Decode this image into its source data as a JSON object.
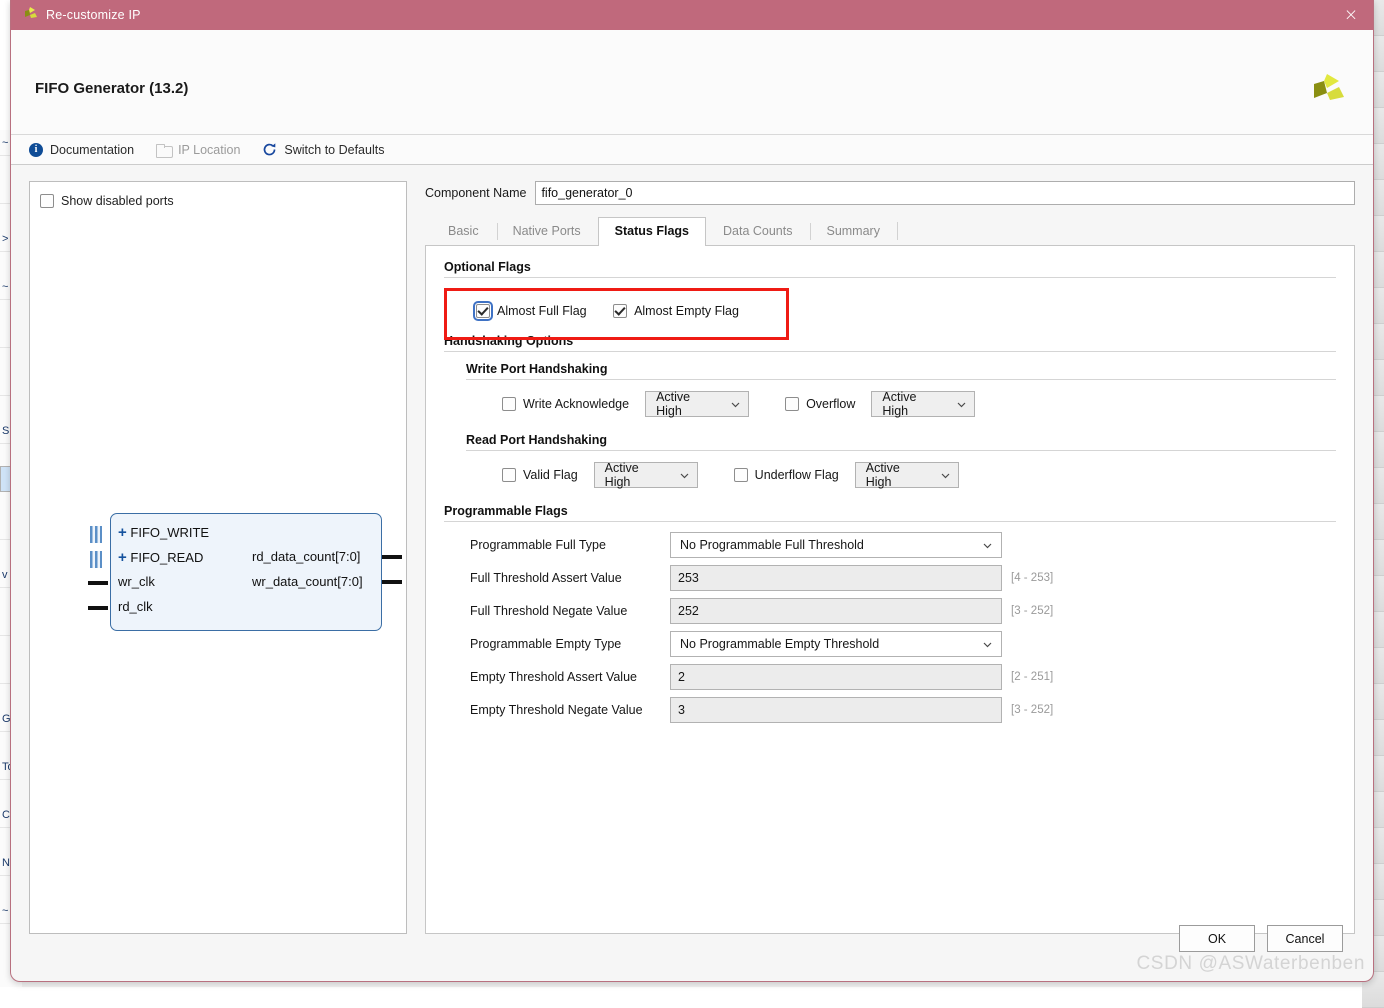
{
  "window": {
    "title": "Re-customize IP",
    "icon": "xilinx-logo-icon",
    "close_label": "×",
    "titlebar_color": "#c0697c"
  },
  "header": {
    "title": "FIFO Generator (13.2)",
    "logo": "xilinx-logo-icon"
  },
  "toolbar": {
    "items": [
      {
        "label": "Documentation",
        "icon": "info-icon",
        "disabled": false
      },
      {
        "label": "IP Location",
        "icon": "folder-icon",
        "disabled": true
      },
      {
        "label": "Switch to Defaults",
        "icon": "refresh-icon",
        "disabled": false
      }
    ]
  },
  "left_panel": {
    "show_disabled_ports": {
      "label": "Show disabled ports",
      "checked": false
    },
    "symbol": {
      "left_ports": [
        {
          "name": "FIFO_WRITE",
          "type": "bus",
          "expandable": true
        },
        {
          "name": "FIFO_READ",
          "type": "bus",
          "expandable": true
        },
        {
          "name": "wr_clk",
          "type": "clock",
          "expandable": false
        },
        {
          "name": "rd_clk",
          "type": "clock",
          "expandable": false
        }
      ],
      "right_ports": [
        {
          "name": "rd_data_count[7:0]",
          "type": "bus"
        },
        {
          "name": "wr_data_count[7:0]",
          "type": "bus"
        }
      ]
    }
  },
  "component_name": {
    "label": "Component Name",
    "value": "fifo_generator_0"
  },
  "tabs": [
    {
      "label": "Basic",
      "active": false
    },
    {
      "label": "Native Ports",
      "active": false
    },
    {
      "label": "Status Flags",
      "active": true
    },
    {
      "label": "Data Counts",
      "active": false
    },
    {
      "label": "Summary",
      "active": false
    }
  ],
  "optional_flags": {
    "title": "Optional Flags",
    "highlighted": true,
    "highlight_color": "#ef1b14",
    "items": [
      {
        "label": "Almost Full Flag",
        "checked": true,
        "focused": true
      },
      {
        "label": "Almost Empty Flag",
        "checked": true,
        "focused": false
      }
    ]
  },
  "handshaking": {
    "title": "Handshaking Options",
    "write_port": {
      "title": "Write Port Handshaking",
      "controls": [
        {
          "label": "Write Acknowledge",
          "checked": false,
          "polarity": "Active High"
        },
        {
          "label": "Overflow",
          "checked": false,
          "polarity": "Active High"
        }
      ]
    },
    "read_port": {
      "title": "Read Port Handshaking",
      "controls": [
        {
          "label": "Valid Flag",
          "checked": false,
          "polarity": "Active High"
        },
        {
          "label": "Underflow Flag",
          "checked": false,
          "polarity": "Active High"
        }
      ]
    }
  },
  "programmable_flags": {
    "title": "Programmable Flags",
    "rows": [
      {
        "label": "Programmable Full Type",
        "kind": "select",
        "value": "No Programmable Full Threshold",
        "range": ""
      },
      {
        "label": "Full Threshold Assert Value",
        "kind": "input",
        "value": "253",
        "range": "[4 - 253]"
      },
      {
        "label": "Full Threshold Negate Value",
        "kind": "input",
        "value": "252",
        "range": "[3 - 252]"
      },
      {
        "label": "Programmable Empty Type",
        "kind": "select",
        "value": "No Programmable Empty Threshold",
        "range": ""
      },
      {
        "label": "Empty Threshold Assert Value",
        "kind": "input",
        "value": "2",
        "range": "[2 - 251]"
      },
      {
        "label": "Empty Threshold Negate Value",
        "kind": "input",
        "value": "3",
        "range": "[3 - 252]"
      }
    ]
  },
  "footer": {
    "ok_label": "OK",
    "cancel_label": "Cancel"
  },
  "watermark": "CSDN @ASWaterbenben"
}
